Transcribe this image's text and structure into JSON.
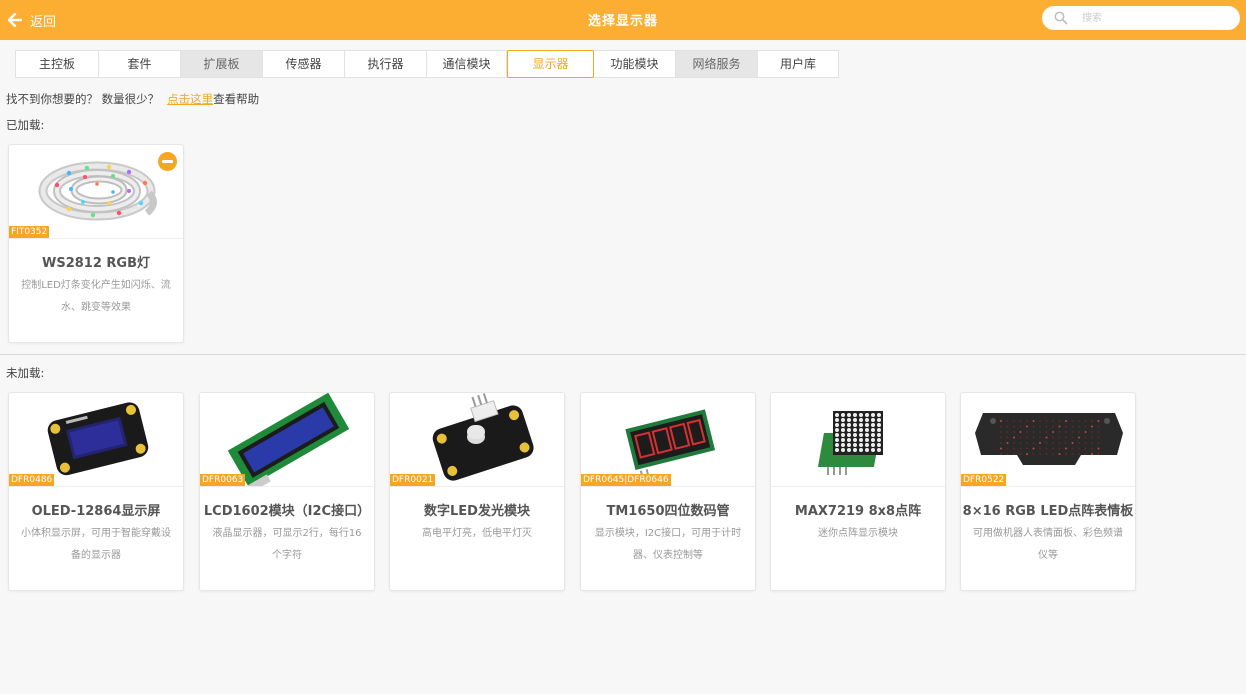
{
  "header": {
    "back_label": "返回",
    "title": "选择显示器",
    "search_placeholder": "搜索"
  },
  "tabs": [
    {
      "label": "主控板"
    },
    {
      "label": "套件"
    },
    {
      "label": "扩展板"
    },
    {
      "label": "传感器"
    },
    {
      "label": "执行器"
    },
    {
      "label": "通信模块"
    },
    {
      "label": "显示器"
    },
    {
      "label": "功能模块"
    },
    {
      "label": "网络服务"
    },
    {
      "label": "用户库"
    }
  ],
  "active_tab": "显示器",
  "help": {
    "text": "找不到你想要的？ 数量很少？",
    "link": "点击这里",
    "suffix": "查看帮助"
  },
  "loaded": {
    "label": "已加载:",
    "items": [
      {
        "sku": "FIT0352",
        "name": "WS2812 RGB灯",
        "desc": "控制LED灯条变化产生如闪烁、流水、跳变等效果",
        "image": "led-strip"
      }
    ]
  },
  "unloaded": {
    "label": "未加载:",
    "items": [
      {
        "sku": "DFR0486",
        "name": "OLED-12864显示屏",
        "desc": "小体积显示屏，可用于智能穿戴设备的显示器",
        "image": "oled-module"
      },
      {
        "sku": "DFR0063",
        "name": "LCD1602模块（I2C接口）",
        "desc": "液晶显示器，可显示2行，每行16个字符",
        "image": "lcd1602-module"
      },
      {
        "sku": "DFR0021",
        "name": "数字LED发光模块",
        "desc": "高电平灯亮，低电平灯灭",
        "image": "led-module"
      },
      {
        "sku": "DFR0645|DFR0646",
        "name": "TM1650四位数码管",
        "desc": "显示模块，I2C接口，可用于计时器、仪表控制等",
        "image": "segment-display"
      },
      {
        "sku": "",
        "name": "MAX7219 8x8点阵",
        "desc": "迷你点阵显示模块",
        "image": "dot-matrix"
      },
      {
        "sku": "DFR0522",
        "name": "8×16 RGB LED点阵表情板",
        "desc": "可用做机器人表情面板、彩色频谱仪等",
        "image": "rgb-face-panel"
      }
    ]
  },
  "colors": {
    "accent": "#fbae32",
    "tab_active": "#f5a623",
    "background": "#f7f7f7"
  }
}
